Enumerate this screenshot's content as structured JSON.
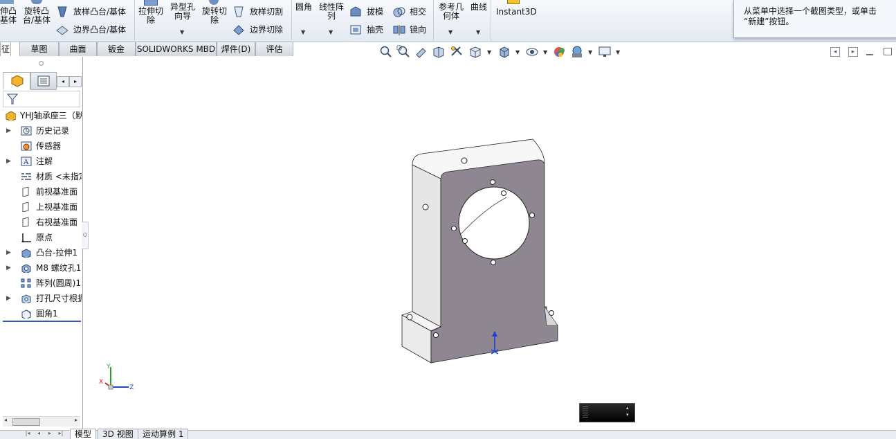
{
  "ribbon": {
    "features": {
      "extrude_boss_partial": "伸凸\n基体",
      "revolve_boss": "旋转凸\n台/基体",
      "loft_boss": "放样凸台/基体",
      "boundary_boss": "边界凸台/基体",
      "extrude_cut": "拉伸切\n除",
      "hole_wizard": "异型孔\n向导",
      "revolve_cut": "旋转切\n除",
      "loft_cut": "放样切割",
      "boundary_cut": "边界切除",
      "fillet": "圆角",
      "linear_pattern": "线性阵\n列",
      "draft": "拔模",
      "shell": "抽壳",
      "intersect": "相交",
      "mirror": "镜向",
      "reference_geometry": "参考几\n何体",
      "curves": "曲线",
      "instant3d": "Instant3D"
    }
  },
  "tooltip": {
    "text": "从菜单中选择一个截图类型，或单击\n“新建”按钮。"
  },
  "tabs": [
    "征",
    "草图",
    "曲面",
    "钣金",
    "SOLIDWORKS MBD",
    "焊件(D)",
    "评估"
  ],
  "feature_tree": {
    "root": "YHJ轴承座三（默",
    "items": [
      {
        "label": "历史记录",
        "expandable": true,
        "icon": "history-icon"
      },
      {
        "label": "传感器",
        "expandable": false,
        "icon": "sensor-icon"
      },
      {
        "label": "注解",
        "expandable": true,
        "icon": "annotation-icon"
      },
      {
        "label": "材质 <未指定>",
        "expandable": false,
        "icon": "material-icon"
      },
      {
        "label": "前视基准面",
        "expandable": false,
        "icon": "plane-icon"
      },
      {
        "label": "上视基准面",
        "expandable": false,
        "icon": "plane-icon"
      },
      {
        "label": "右视基准面",
        "expandable": false,
        "icon": "plane-icon"
      },
      {
        "label": "原点",
        "expandable": false,
        "icon": "origin-icon"
      },
      {
        "label": "凸台-拉伸1",
        "expandable": true,
        "icon": "extrude-icon"
      },
      {
        "label": "M8 螺纹孔1",
        "expandable": true,
        "icon": "hole-icon"
      },
      {
        "label": "阵列(圆周)1",
        "expandable": false,
        "icon": "pattern-icon"
      },
      {
        "label": "打孔尺寸根据",
        "expandable": true,
        "icon": "hole-size-icon"
      },
      {
        "label": "圆角1",
        "expandable": false,
        "icon": "fillet-icon"
      }
    ]
  },
  "triad": {
    "x": "X",
    "y": "Y",
    "z": "Z"
  },
  "bottom_tabs": [
    "模型",
    "3D 视图",
    "运动算例 1"
  ],
  "colors": {
    "part_face": "#8e8792",
    "part_side": "#e8e8e8",
    "ribbon": "#e9eef5"
  }
}
